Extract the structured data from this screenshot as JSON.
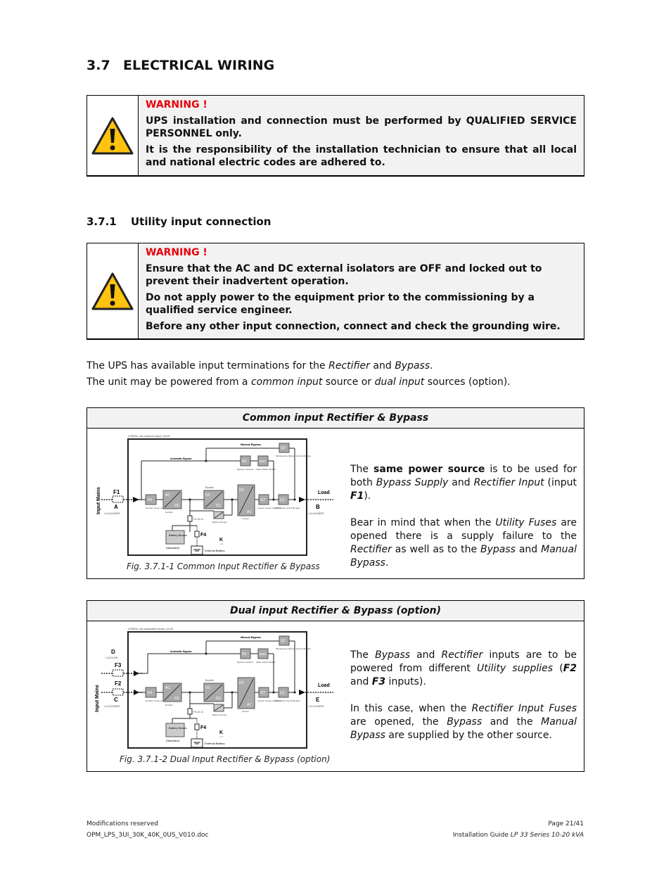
{
  "section": {
    "number": "3.7",
    "title": "ELECTRICAL WIRING"
  },
  "warning1": {
    "icon": "warning-triangle-icon",
    "title": "WARNING !",
    "paragraphs": [
      "UPS installation and connection must be performed by QUALIFIED SERVICE PERSONNEL only.",
      "It is the responsibility of the installation technician to ensure that all local and national electric codes are adhered to."
    ]
  },
  "subsection": {
    "number": "3.7.1",
    "title": "Utility input connection"
  },
  "warning2": {
    "icon": "warning-triangle-icon",
    "title": "WARNING !",
    "paragraphs": [
      "Ensure that the AC and DC external isolators are OFF and locked out to prevent their inadvertent operation.",
      "Do not apply power to the equipment prior to the commissioning by a qualified service engineer.",
      "Before any other input connection, connect and check the grounding wire."
    ]
  },
  "intro": {
    "line1": {
      "a": "The UPS has available input terminations for the ",
      "b": "Rectifier",
      "c": " and ",
      "d": "Bypass",
      "e": "."
    },
    "line2": {
      "a": "The unit may be powered from a ",
      "b": "common input",
      "c": " source or ",
      "d": "dual input",
      "e": " sources (option)."
    }
  },
  "figure1": {
    "header": "Common input Rectifier & Bypass",
    "caption": "Fig. 3.7.1-1   Common Input Rectifier & Bypass",
    "diagram": {
      "file_label": "LP833U_bd-common input_01US",
      "input_label": "Input Mains",
      "fuse_in": "F1",
      "terminal_in": "A",
      "terminal_in_spec": "L1/L2/L3/N/PE",
      "load_label": "Load",
      "terminal_out": "B",
      "terminal_out_spec": "L1/L2/L3/N/PE",
      "manual_bypass": "Manual Bypass",
      "automatic_bypass": "Automatic Bypass",
      "k4": "K4",
      "k4_label": "Rectifier Inputs Contactor",
      "rect_ac": "AC",
      "rect_dc": "DC",
      "rect_label": "Rectifier",
      "booster_label": "Booster",
      "boost_dc1": "DC",
      "boost_dc2": "DC",
      "inv_dc": "DC",
      "inv_ac": "AC",
      "inv_label": "Inverter",
      "k7": "K7",
      "k7_label": "Inverter Output Contactor",
      "q1": "Q1",
      "q1_label": "UPS Output Circuit Breaker",
      "k6": "K6",
      "k6_label": "Bypass Contactor",
      "ssm": "SSM",
      "ssm_label": "Static Switch Module",
      "q2": "Q2",
      "q2_label": "Maintenance Bypass Service Breaker",
      "charger_label": "Battery Charge",
      "fuse_batt": "F9-10-11",
      "battery": "Battery Blocks",
      "battery_std": "(Standard)",
      "f4": "F4",
      "k": "K",
      "k_sub": "+ 0 -",
      "ext_battery": "External Battery"
    },
    "description": {
      "p1": {
        "a": "The ",
        "b": "same power source",
        "c": " is to be used for both ",
        "d": "Bypass Supply",
        "e": " and ",
        "f": "Rectifier Input",
        "g": " (input ",
        "h": "F1",
        "i": ")."
      },
      "p2": {
        "a": "Bear in mind that when the ",
        "b": "Utility Fuses",
        "c": " are opened there is a supply failure to the ",
        "d": "Rectifier",
        "e": " as well as to the ",
        "f": "Bypass",
        "g": " and ",
        "h": "Manual Bypass",
        "i": "."
      }
    }
  },
  "figure2": {
    "header": "Dual input Rectifier & Bypass (option)",
    "caption": "Fig. 3.7.1-2   Dual Input Rectifier & Bypass (option)",
    "diagram": {
      "file_label": "LP833U_bd-separated inputs_01US",
      "input_label": "Input Mains",
      "terminal_byp": "D",
      "terminal_byp_spec": "L1/L2/L3/N",
      "fuse_byp": "F3",
      "fuse_in": "F2",
      "terminal_in": "C",
      "terminal_in_spec": "L1/L2/L3/N/PE",
      "load_label": "Load",
      "terminal_out": "E",
      "terminal_out_spec": "L1/L2/L3/N/PE",
      "manual_bypass": "Manual Bypass",
      "automatic_bypass": "Automatic Bypass",
      "k4": "K4",
      "k4_label": "Rectifier Inputs Contactor",
      "rect_ac": "AC",
      "rect_dc": "DC",
      "rect_label": "Rectifier",
      "booster_label": "Booster",
      "boost_dc1": "DC",
      "boost_dc2": "DC",
      "inv_dc": "DC",
      "inv_ac": "AC",
      "inv_label": "Inverter",
      "k7": "K7",
      "k7_label": "Inverter Output Contactor",
      "q1": "Q1",
      "q1_label": "UPS Output Circuit Breaker",
      "k6": "K6",
      "k6_label": "Bypass Contactor",
      "ssm": "SSM",
      "ssm_label": "Static Switch Module",
      "q2": "Q2",
      "q2_label": "Maintenance Bypass Service Breaker",
      "charger_label": "Battery Charge",
      "fuse_batt": "F9-10-11",
      "battery": "Battery Blocks",
      "battery_std": "(Standard)",
      "f4": "F4",
      "k": "K",
      "k_sub": "+ 0 -",
      "ext_battery": "External Battery"
    },
    "description": {
      "p1": {
        "a": "The ",
        "b": "Bypass",
        "c": " and ",
        "d": "Rectifier",
        "e": " inputs are to be powered from different ",
        "f": "Utility supplies",
        "g": " (",
        "h": "F2",
        "i": " and ",
        "j": "F3",
        "k": " inputs)."
      },
      "p2": {
        "a": "In this case, when the ",
        "b": "Rectifier Input Fuses",
        "c": " are opened, the ",
        "d": "Bypass",
        "e": " and the ",
        "f": "Manual Bypass",
        "g": " are supplied by the other source."
      }
    }
  },
  "footer": {
    "left1": "Modifications reserved",
    "left2": "OPM_LPS_3UI_30K_40K_0US_V010.doc",
    "right1": "Page 21/41",
    "right2_a": "Installation Guide ",
    "right2_b": "LP 33 Series 10-20 kVA"
  }
}
